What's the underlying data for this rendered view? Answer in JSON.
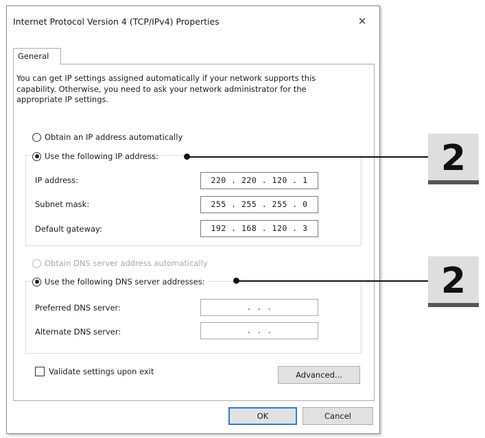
{
  "window": {
    "title": "Internet Protocol Version 4 (TCP/IPv4) Properties",
    "close_glyph": "✕"
  },
  "tabs": [
    {
      "label": "General",
      "active": true
    }
  ],
  "intro_text": "You can get IP settings assigned automatically if your network supports this capability. Otherwise, you need to ask your network administrator for the appropriate IP settings.",
  "ip_section": {
    "auto_option": {
      "label": "Obtain an IP address automatically",
      "checked": false
    },
    "manual_option": {
      "label": "Use the following IP address:",
      "checked": true
    },
    "fields": [
      {
        "label": "IP address:",
        "value": "220 . 220 . 120 .  1"
      },
      {
        "label": "Subnet mask:",
        "value": "255 . 255 . 255 .  0"
      },
      {
        "label": "Default gateway:",
        "value": "192 . 168 . 120 .  3"
      }
    ]
  },
  "dns_section": {
    "auto_option": {
      "label": "Obtain DNS server address automatically",
      "checked": false,
      "disabled": true
    },
    "manual_option": {
      "label": "Use the following DNS server addresses:",
      "checked": true
    },
    "fields": [
      {
        "label": "Preferred DNS server:",
        "value": ".      .      ."
      },
      {
        "label": "Alternate DNS server:",
        "value": ".      .      ."
      }
    ]
  },
  "validate_checkbox": {
    "label": "Validate settings upon exit",
    "checked": false
  },
  "buttons": {
    "advanced": "Advanced...",
    "ok": "OK",
    "cancel": "Cancel"
  },
  "callouts": [
    {
      "number": "2"
    },
    {
      "number": "2"
    }
  ],
  "colors": {
    "default_button_border": "#2f7ad9",
    "badge_background": "#dedede",
    "badge_underline": "#555555"
  }
}
